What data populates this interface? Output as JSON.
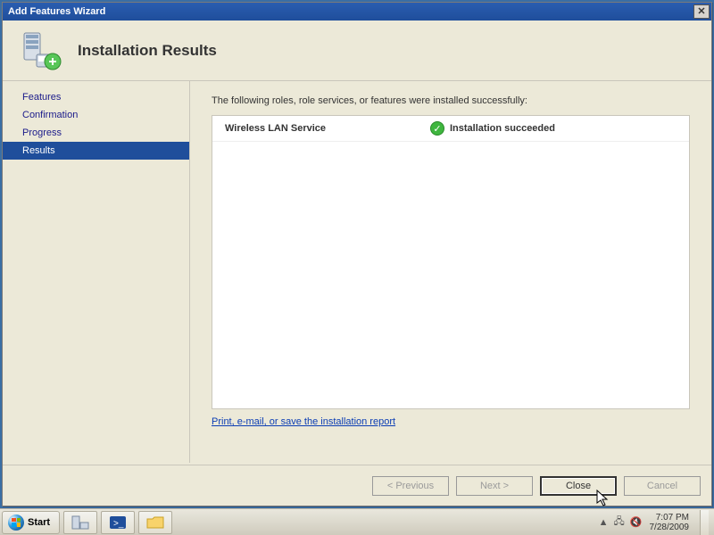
{
  "window": {
    "title": "Add Features Wizard"
  },
  "header": {
    "page_title": "Installation Results"
  },
  "sidebar": {
    "items": [
      {
        "label": "Features",
        "selected": false
      },
      {
        "label": "Confirmation",
        "selected": false
      },
      {
        "label": "Progress",
        "selected": false
      },
      {
        "label": "Results",
        "selected": true
      }
    ]
  },
  "content": {
    "intro": "The following roles, role services, or features were installed successfully:",
    "results": [
      {
        "name": "Wireless LAN Service",
        "status": "Installation succeeded"
      }
    ],
    "report_link": "Print, e-mail, or save the installation report"
  },
  "footer": {
    "previous": "< Previous",
    "next": "Next >",
    "close": "Close",
    "cancel": "Cancel"
  },
  "taskbar": {
    "start": "Start",
    "time": "7:07 PM",
    "date": "7/28/2009"
  }
}
